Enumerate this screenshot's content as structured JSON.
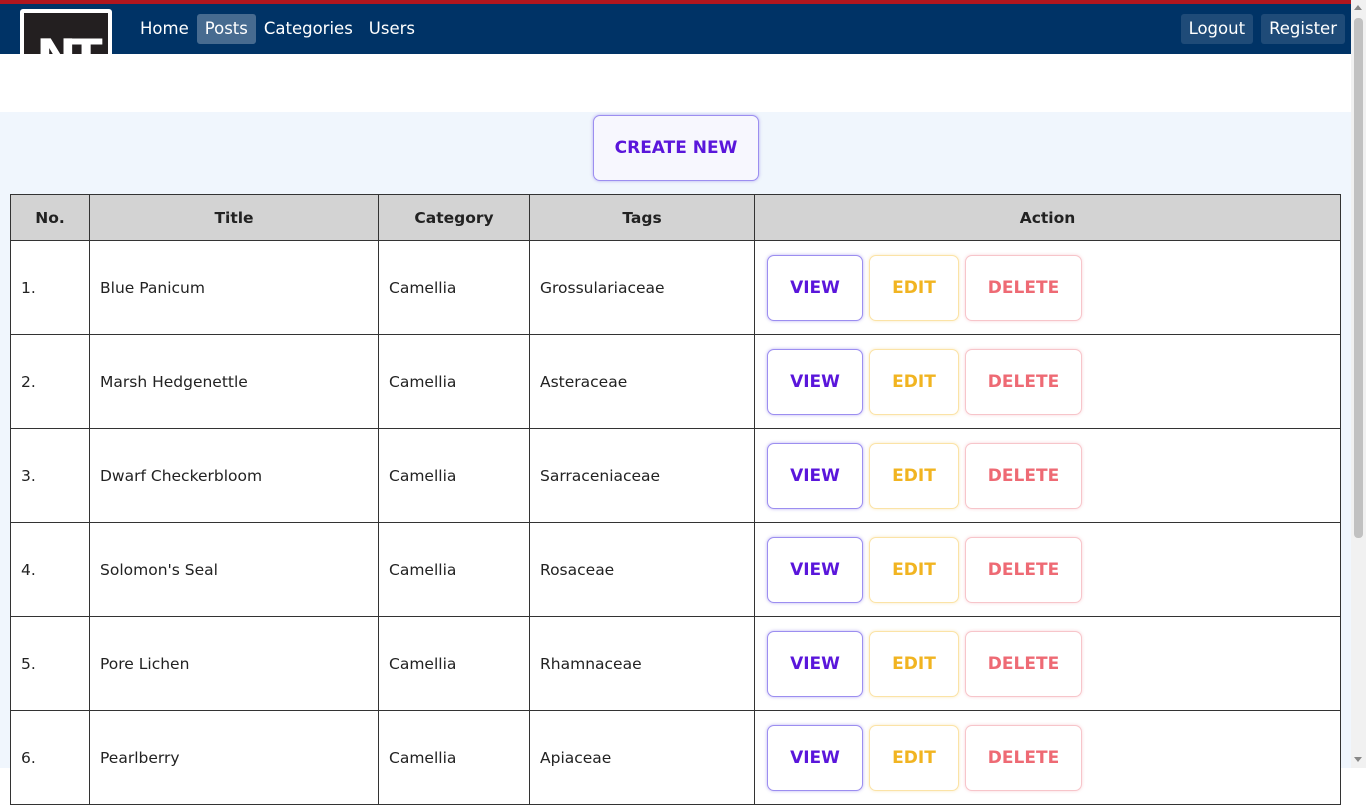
{
  "logo": {
    "text": "NT"
  },
  "nav": {
    "left": [
      {
        "label": "Home",
        "active": false
      },
      {
        "label": "Posts",
        "active": true
      },
      {
        "label": "Categories",
        "active": false
      },
      {
        "label": "Users",
        "active": false
      }
    ],
    "right": [
      {
        "label": "Logout"
      },
      {
        "label": "Register"
      }
    ]
  },
  "create_button": "CREATE NEW",
  "table": {
    "headers": [
      "No.",
      "Title",
      "Category",
      "Tags",
      "Action"
    ],
    "rows": [
      {
        "no": "1.",
        "title": "Blue Panicum",
        "category": "Camellia",
        "tags": "Grossulariaceae"
      },
      {
        "no": "2.",
        "title": "Marsh Hedgenettle",
        "category": "Camellia",
        "tags": "Asteraceae"
      },
      {
        "no": "3.",
        "title": "Dwarf Checkerbloom",
        "category": "Camellia",
        "tags": "Sarraceniaceae"
      },
      {
        "no": "4.",
        "title": "Solomon's Seal",
        "category": "Camellia",
        "tags": "Rosaceae"
      },
      {
        "no": "5.",
        "title": "Pore Lichen",
        "category": "Camellia",
        "tags": "Rhamnaceae"
      },
      {
        "no": "6.",
        "title": "Pearlberry",
        "category": "Camellia",
        "tags": "Apiaceae"
      }
    ],
    "actions": {
      "view": "VIEW",
      "edit": "EDIT",
      "delete": "DELETE"
    }
  },
  "colors": {
    "navbar": "#003366",
    "top_accent": "#b0161e",
    "view": "#5a16db",
    "edit": "#f1b421",
    "delete": "#ee6a74",
    "content_bg": "#f0f6fd"
  }
}
